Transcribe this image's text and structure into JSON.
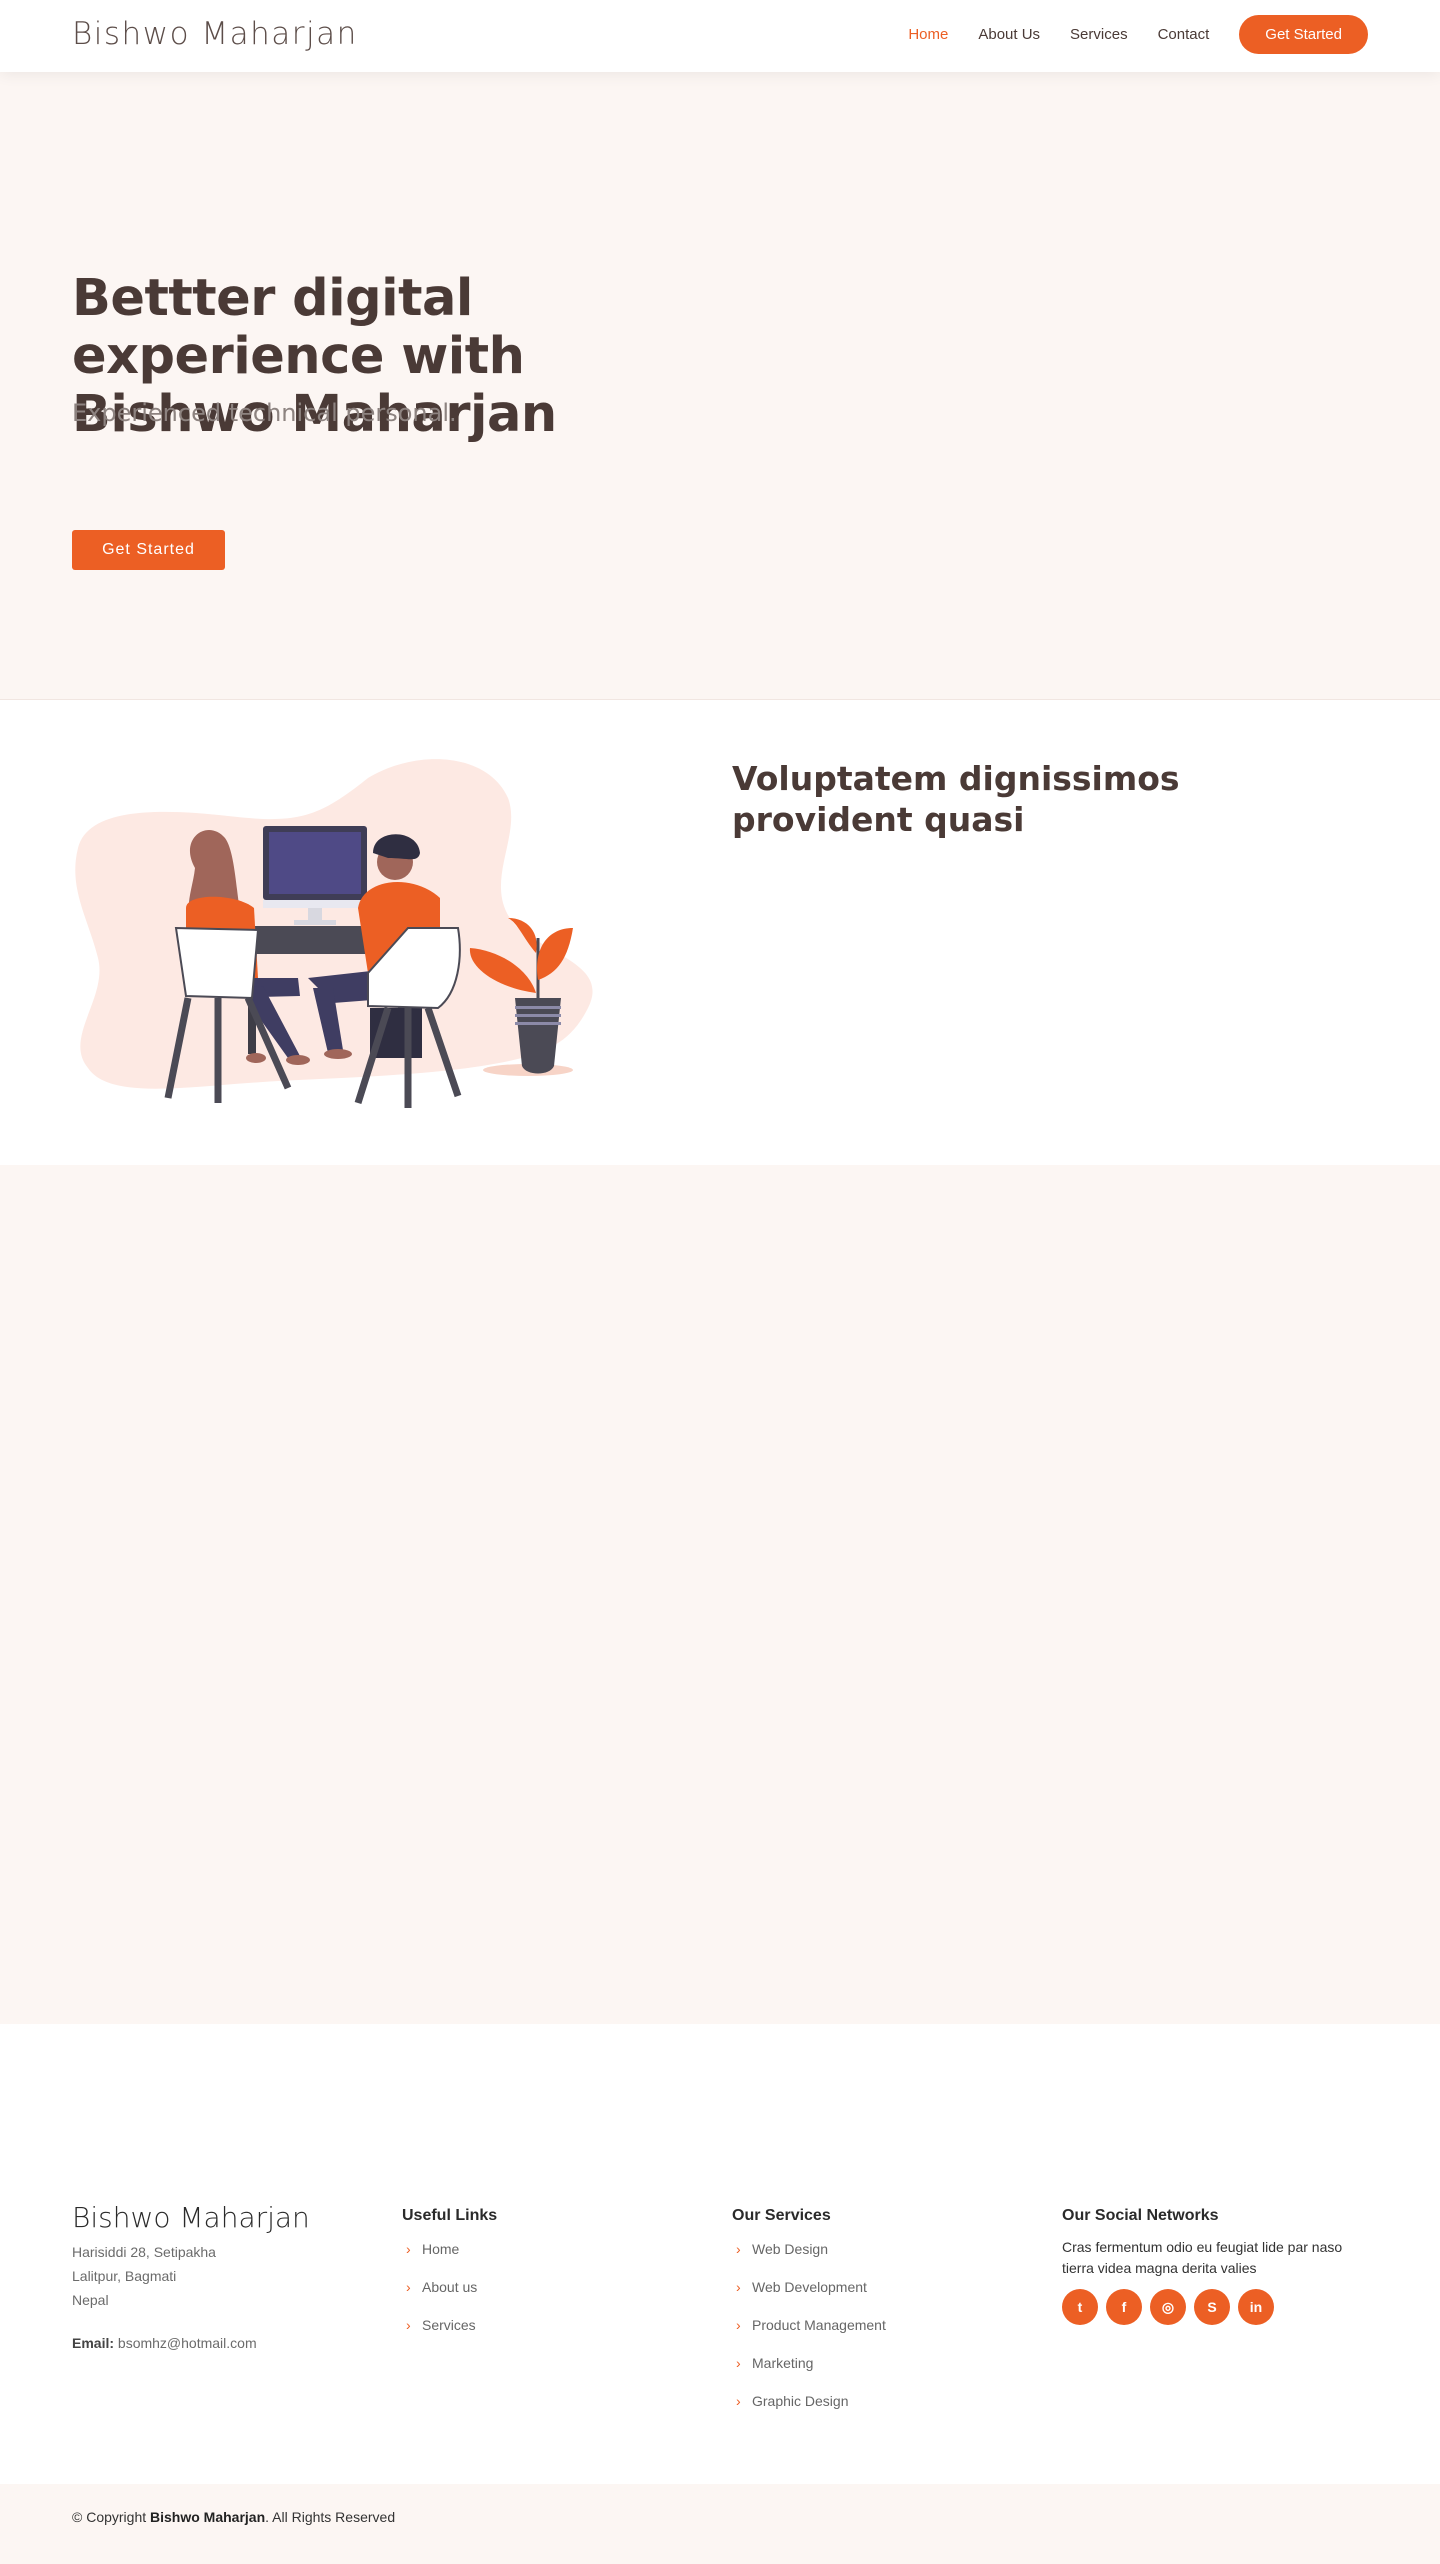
{
  "header": {
    "logo": "Bishwo Maharjan",
    "nav": [
      "Home",
      "About Us",
      "Services",
      "Contact"
    ],
    "cta": "Get Started"
  },
  "hero": {
    "title": "Bettter digital experience with Bishwo Maharjan",
    "subtitle": "Experienced technical personal.",
    "button": "Get Started"
  },
  "about": {
    "title": "Voluptatem dignissimos provident quasi"
  },
  "footer": {
    "brand": "Bishwo Maharjan",
    "address": [
      "Harisiddi 28, Setipakha",
      "Lalitpur, Bagmati",
      "Nepal"
    ],
    "email_label": "Email:",
    "email": "bsomhz@hotmail.com",
    "useful_links": {
      "title": "Useful Links",
      "items": [
        "Home",
        "About us",
        "Services"
      ]
    },
    "services": {
      "title": "Our Services",
      "items": [
        "Web Design",
        "Web Development",
        "Product Management",
        "Marketing",
        "Graphic Design"
      ]
    },
    "social": {
      "title": "Our Social Networks",
      "text": "Cras fermentum odio eu feugiat lide par naso tierra videa magna derita valies",
      "icons": [
        "twitter-icon",
        "facebook-icon",
        "instagram-icon",
        "skype-icon",
        "linkedin-icon"
      ],
      "glyphs": [
        "t",
        "f",
        "◎",
        "S",
        "in"
      ]
    },
    "copyright_prefix": "© Copyright",
    "copyright_name": "Bishwo Maharjan",
    "copyright_suffix": ". All Rights Reserved"
  },
  "colors": {
    "accent": "#ec5f24",
    "heading": "#4a3a36",
    "section_bg": "#fcf6f3"
  }
}
